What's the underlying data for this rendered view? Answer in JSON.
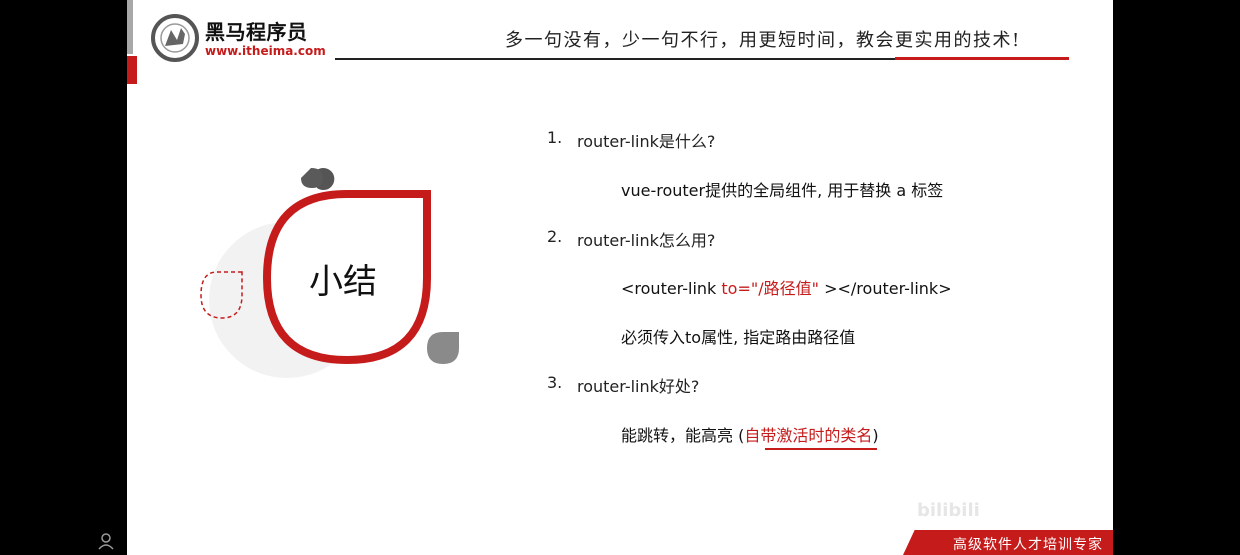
{
  "header": {
    "logo_name": "黑马程序员",
    "logo_url": "www.itheima.com",
    "slogan": "多一句没有，少一句不行，用更短时间，教会更实用的技术!"
  },
  "summary": {
    "title": "小结"
  },
  "questions": [
    {
      "number": "1.",
      "text": "router-link是什么?",
      "answer": "vue-router提供的全局组件, 用于替换 a 标签"
    },
    {
      "number": "2.",
      "text": "router-link怎么用?",
      "answer_code_prefix": "<router-link",
      "answer_code_attr": "to=\"/路径值\"",
      "answer_code_suffix": "></router-link>",
      "answer_note": "必须传入to属性, 指定路由路径值"
    },
    {
      "number": "3.",
      "text": "router-link好处?",
      "answer_prefix": "能跳转，能高亮 (",
      "answer_highlight": "自带激活时的类名",
      "answer_suffix": ")"
    }
  ],
  "footer": {
    "tagline": "高级软件人才培训专家",
    "watermark": "bilibili"
  },
  "colors": {
    "brand_red": "#c61b1b",
    "gray": "#8a8a8a",
    "text": "#222222"
  },
  "icons": {
    "logo": "horse-logo-icon",
    "teardrop_small": "teardrop-icon",
    "corner": "user-icon"
  }
}
